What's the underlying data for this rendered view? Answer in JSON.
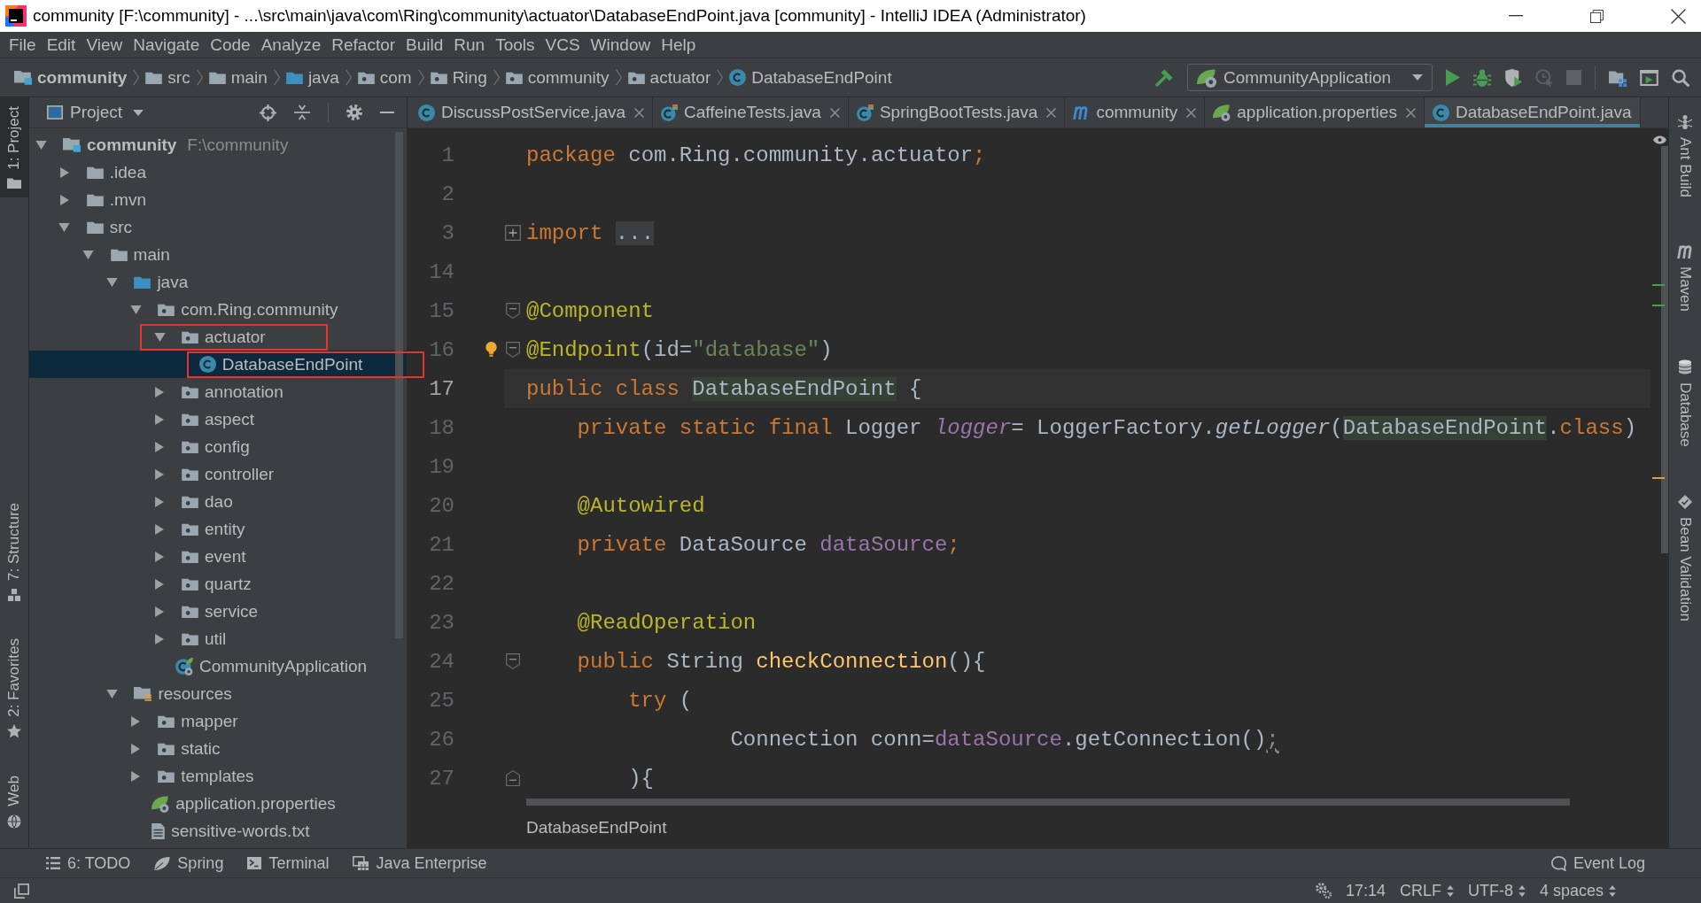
{
  "window": {
    "title": "community [F:\\community] - ...\\src\\main\\java\\com\\Ring\\community\\actuator\\DatabaseEndPoint.java [community] - IntelliJ IDEA (Administrator)"
  },
  "menu": [
    "File",
    "Edit",
    "View",
    "Navigate",
    "Code",
    "Analyze",
    "Refactor",
    "Build",
    "Run",
    "Tools",
    "VCS",
    "Window",
    "Help"
  ],
  "breadcrumbs": [
    {
      "label": "community",
      "kind": "module"
    },
    {
      "label": "src",
      "kind": "folder"
    },
    {
      "label": "main",
      "kind": "folder"
    },
    {
      "label": "java",
      "kind": "source"
    },
    {
      "label": "com",
      "kind": "package"
    },
    {
      "label": "Ring",
      "kind": "package"
    },
    {
      "label": "community",
      "kind": "package"
    },
    {
      "label": "actuator",
      "kind": "package"
    },
    {
      "label": "DatabaseEndPoint",
      "kind": "class"
    }
  ],
  "toolbar": [
    {
      "kind": "build",
      "disabled": false
    },
    {
      "kind": "run_config",
      "label": "CommunityApplication"
    },
    {
      "kind": "run",
      "disabled": false
    },
    {
      "kind": "debug",
      "disabled": false
    },
    {
      "kind": "coverage",
      "disabled": false
    },
    {
      "kind": "profile",
      "disabled": true
    },
    {
      "kind": "stop",
      "disabled": true
    },
    {
      "kind": "separator"
    },
    {
      "kind": "structure",
      "disabled": false
    },
    {
      "kind": "window",
      "disabled": false
    },
    {
      "kind": "search",
      "disabled": false
    }
  ],
  "left_stripe": {
    "top": [
      {
        "label": "1: Project",
        "kind": "project",
        "selected": true
      }
    ],
    "bottom": [
      {
        "label": "7: Structure",
        "kind": "structure",
        "selected": false
      },
      {
        "label": "2: Favorites",
        "kind": "favorites",
        "selected": false
      },
      {
        "label": "Web",
        "kind": "web",
        "selected": false
      }
    ]
  },
  "project": {
    "title": "Project",
    "tree": [
      {
        "label": "community",
        "detail": "F:\\community",
        "kind": "module",
        "expanded": true,
        "selected": false,
        "marked": false,
        "children": [
          {
            "label": ".idea",
            "kind": "folder",
            "expanded": false,
            "selected": false,
            "marked": false
          },
          {
            "label": ".mvn",
            "kind": "folder",
            "expanded": false,
            "selected": false,
            "marked": false
          },
          {
            "label": "src",
            "kind": "folder",
            "expanded": true,
            "selected": false,
            "marked": false,
            "children": [
              {
                "label": "main",
                "kind": "folder",
                "expanded": true,
                "selected": false,
                "marked": false,
                "children": [
                  {
                    "label": "java",
                    "kind": "source",
                    "expanded": true,
                    "selected": false,
                    "marked": false,
                    "children": [
                      {
                        "label": "com.Ring.community",
                        "kind": "package",
                        "expanded": true,
                        "selected": false,
                        "marked": false,
                        "children": [
                          {
                            "label": "actuator",
                            "kind": "package",
                            "expanded": true,
                            "selected": false,
                            "marked": true,
                            "children": [
                              {
                                "label": "DatabaseEndPoint",
                                "kind": "class",
                                "selected": true,
                                "marked": true
                              }
                            ]
                          },
                          {
                            "label": "annotation",
                            "kind": "package",
                            "expanded": false,
                            "selected": false,
                            "marked": false
                          },
                          {
                            "label": "aspect",
                            "kind": "package",
                            "expanded": false,
                            "selected": false,
                            "marked": false
                          },
                          {
                            "label": "config",
                            "kind": "package",
                            "expanded": false,
                            "selected": false,
                            "marked": false
                          },
                          {
                            "label": "controller",
                            "kind": "package",
                            "expanded": false,
                            "selected": false,
                            "marked": false
                          },
                          {
                            "label": "dao",
                            "kind": "package",
                            "expanded": false,
                            "selected": false,
                            "marked": false
                          },
                          {
                            "label": "entity",
                            "kind": "package",
                            "expanded": false,
                            "selected": false,
                            "marked": false
                          },
                          {
                            "label": "event",
                            "kind": "package",
                            "expanded": false,
                            "selected": false,
                            "marked": false
                          },
                          {
                            "label": "quartz",
                            "kind": "package",
                            "expanded": false,
                            "selected": false,
                            "marked": false
                          },
                          {
                            "label": "service",
                            "kind": "package",
                            "expanded": false,
                            "selected": false,
                            "marked": false
                          },
                          {
                            "label": "util",
                            "kind": "package",
                            "expanded": false,
                            "selected": false,
                            "marked": false
                          },
                          {
                            "label": "CommunityApplication",
                            "kind": "spring_class",
                            "selected": false,
                            "marked": false
                          }
                        ]
                      }
                    ]
                  },
                  {
                    "label": "resources",
                    "kind": "resources",
                    "expanded": true,
                    "selected": false,
                    "marked": false,
                    "children": [
                      {
                        "label": "mapper",
                        "kind": "package",
                        "expanded": false,
                        "selected": false,
                        "marked": false
                      },
                      {
                        "label": "static",
                        "kind": "package",
                        "expanded": false,
                        "selected": false,
                        "marked": false
                      },
                      {
                        "label": "templates",
                        "kind": "package",
                        "expanded": false,
                        "selected": false,
                        "marked": false
                      },
                      {
                        "label": "application.properties",
                        "kind": "properties",
                        "selected": false,
                        "marked": false
                      },
                      {
                        "label": "sensitive-words.txt",
                        "kind": "text",
                        "selected": false,
                        "marked": false
                      }
                    ]
                  }
                ]
              }
            ]
          }
        ]
      }
    ]
  },
  "editor": {
    "tabs": [
      {
        "label": "DiscussPostService.java",
        "kind": "class",
        "selected": false,
        "closable": true
      },
      {
        "label": "CaffeineTests.java",
        "kind": "test",
        "selected": false,
        "closable": true
      },
      {
        "label": "SpringBootTests.java",
        "kind": "test",
        "selected": false,
        "closable": true
      },
      {
        "label": "community",
        "kind": "maven",
        "selected": false,
        "closable": true
      },
      {
        "label": "application.properties",
        "kind": "properties",
        "selected": false,
        "closable": true
      },
      {
        "label": "DatabaseEndPoint.java",
        "kind": "class",
        "selected": true,
        "closable": false
      }
    ],
    "lines": [
      {
        "number": "1",
        "current": false,
        "intention": false,
        "tokens": [
          {
            "kind": "kw",
            "text": "package"
          },
          {
            "kind": "plain",
            "text": " com.Ring.community.actuator"
          },
          {
            "kind": "kw",
            "text": ";"
          }
        ]
      },
      {
        "number": "2",
        "current": false,
        "intention": false
      },
      {
        "number": "3",
        "current": false,
        "intention": false,
        "fold": {
          "kind": "expand"
        },
        "tokens": [
          {
            "kind": "kw",
            "text": "import "
          },
          {
            "kind": "folded",
            "text": "..."
          }
        ]
      },
      {
        "number": "14",
        "current": false,
        "intention": false
      },
      {
        "number": "15",
        "current": false,
        "intention": false,
        "fold": {
          "kind": "start"
        },
        "tokens": [
          {
            "kind": "ann",
            "text": "@Component"
          }
        ]
      },
      {
        "number": "16",
        "current": false,
        "intention": true,
        "fold": {
          "kind": "start"
        },
        "tokens": [
          {
            "kind": "ann",
            "text": "@Endpoint"
          },
          {
            "kind": "plain",
            "text": "(id="
          },
          {
            "kind": "str",
            "text": "\"database\""
          },
          {
            "kind": "plain",
            "text": ")"
          }
        ]
      },
      {
        "number": "17",
        "current": true,
        "intention": false,
        "tokens": [
          {
            "kind": "kw",
            "text": "public class "
          },
          {
            "kind": "usage",
            "text": "DatabaseEndPoint"
          },
          {
            "kind": "plain",
            "text": " {"
          }
        ]
      },
      {
        "number": "18",
        "current": false,
        "intention": false,
        "tokens": [
          {
            "kind": "kw",
            "text": "    private static final"
          },
          {
            "kind": "plain",
            "text": " Logger "
          },
          {
            "kind": "sfield",
            "text": "logger"
          },
          {
            "kind": "plain",
            "text": "= LoggerFactory."
          },
          {
            "kind": "smethod",
            "text": "getLogger"
          },
          {
            "kind": "plain",
            "text": "("
          },
          {
            "kind": "usage",
            "text": "DatabaseEndPoint"
          },
          {
            "kind": "plain",
            "text": "."
          },
          {
            "kind": "kw",
            "text": "class"
          },
          {
            "kind": "plain",
            "text": ")"
          }
        ]
      },
      {
        "number": "19",
        "current": false,
        "intention": false
      },
      {
        "number": "20",
        "current": false,
        "intention": false,
        "tokens": [
          {
            "kind": "ann",
            "text": "    @Autowired"
          }
        ]
      },
      {
        "number": "21",
        "current": false,
        "intention": false,
        "tokens": [
          {
            "kind": "kw",
            "text": "    private"
          },
          {
            "kind": "plain",
            "text": " DataSource "
          },
          {
            "kind": "field",
            "text": "dataSource"
          },
          {
            "kind": "kw",
            "text": ";"
          }
        ]
      },
      {
        "number": "22",
        "current": false,
        "intention": false
      },
      {
        "number": "23",
        "current": false,
        "intention": false,
        "tokens": [
          {
            "kind": "ann",
            "text": "    @ReadOperation"
          }
        ]
      },
      {
        "number": "24",
        "current": false,
        "intention": false,
        "fold": {
          "kind": "start"
        },
        "tokens": [
          {
            "kind": "kw",
            "text": "    public"
          },
          {
            "kind": "plain",
            "text": " String "
          },
          {
            "kind": "mdecl",
            "text": "checkConnection"
          },
          {
            "kind": "plain",
            "text": "(){"
          }
        ]
      },
      {
        "number": "25",
        "current": false,
        "intention": false,
        "tokens": [
          {
            "kind": "kw",
            "text": "        try"
          },
          {
            "kind": "plain",
            "text": " ("
          }
        ]
      },
      {
        "number": "26",
        "current": false,
        "intention": false,
        "tokens": [
          {
            "kind": "plain",
            "text": "                Connection conn="
          },
          {
            "kind": "field",
            "text": "dataSource"
          },
          {
            "kind": "plain",
            "text": ".getConnection()"
          },
          {
            "kind": "warn",
            "text": ";"
          }
        ]
      },
      {
        "number": "27",
        "current": false,
        "intention": false,
        "fold": {
          "kind": "end"
        },
        "tokens": [
          {
            "kind": "plain",
            "text": "        ){"
          }
        ]
      }
    ],
    "breadcrumb": "DatabaseEndPoint"
  },
  "right_stripe": [
    {
      "label": "Ant Build",
      "kind": "ant",
      "selected": false
    },
    {
      "label": "Maven",
      "kind": "maven",
      "selected": false
    },
    {
      "label": "Database",
      "kind": "database",
      "selected": false
    },
    {
      "label": "Bean Validation",
      "kind": "bean",
      "selected": false
    }
  ],
  "bottom_bar": {
    "tools": [
      {
        "label": "6: TODO",
        "kind": "todo"
      },
      {
        "label": "Spring",
        "kind": "spring"
      },
      {
        "label": "Terminal",
        "kind": "terminal"
      },
      {
        "label": "Java Enterprise",
        "kind": "javaee"
      }
    ],
    "event_log": "Event Log"
  },
  "status_bar": {
    "caret": "17:14",
    "line_separator": "CRLF",
    "encoding": "UTF-8",
    "indent": "4 spaces"
  }
}
